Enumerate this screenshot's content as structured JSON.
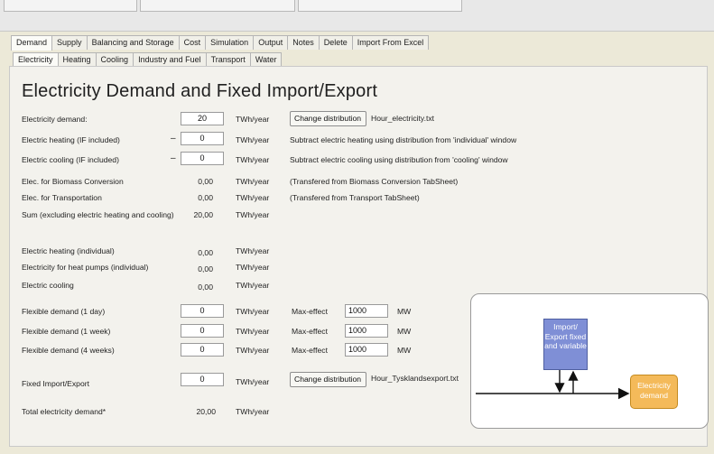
{
  "window": {
    "top_boxes": [
      "",
      "",
      ""
    ]
  },
  "main_tabs": [
    {
      "label": "Demand",
      "active": true
    },
    {
      "label": "Supply",
      "active": false
    },
    {
      "label": "Balancing and Storage",
      "active": false
    },
    {
      "label": "Cost",
      "active": false
    },
    {
      "label": "Simulation",
      "active": false
    },
    {
      "label": "Output",
      "active": false
    },
    {
      "label": "Notes",
      "active": false
    },
    {
      "label": "Delete",
      "active": false
    },
    {
      "label": "Import From Excel",
      "active": false
    }
  ],
  "sub_tabs": [
    {
      "label": "Electricity",
      "active": true
    },
    {
      "label": "Heating",
      "active": false
    },
    {
      "label": "Cooling",
      "active": false
    },
    {
      "label": "Industry and Fuel",
      "active": false
    },
    {
      "label": "Transport",
      "active": false
    },
    {
      "label": "Water",
      "active": false
    }
  ],
  "page": {
    "title": "Electricity Demand and Fixed Import/Export"
  },
  "rows": {
    "electricity_demand": {
      "label": "Electricity demand:",
      "value": "20",
      "unit": "TWh/year",
      "button": "Change distribution",
      "file": "Hour_electricity.txt"
    },
    "electric_heating": {
      "label": "Electric heating (IF included)",
      "minus": "–",
      "value": "0",
      "unit": "TWh/year",
      "note": "Subtract electric heating using distribution from 'individual' window"
    },
    "electric_cooling": {
      "label": "Electric cooling (IF included)",
      "minus": "–",
      "value": "0",
      "unit": "TWh/year",
      "note": "Subtract electric cooling using distribution from 'cooling' window"
    },
    "biomass": {
      "label": "Elec. for Biomass Conversion",
      "value": "0,00",
      "unit": "TWh/year",
      "note": "(Transfered from Biomass Conversion TabSheet)"
    },
    "transport": {
      "label": "Elec. for Transportation",
      "value": "0,00",
      "unit": "TWh/year",
      "note": "(Transfered from Transport TabSheet)"
    },
    "sum": {
      "label": "Sum (excluding electric heating and cooling)",
      "value": "20,00",
      "unit": "TWh/year"
    },
    "heating_individual": {
      "label": "Electric heating (individual)",
      "value": "0,00",
      "unit": "TWh/year"
    },
    "heat_pumps": {
      "label": "Electricity for heat pumps (individual)",
      "value": "0,00",
      "unit": "TWh/year"
    },
    "cooling": {
      "label": "Electric cooling",
      "value": "0,00",
      "unit": "TWh/year"
    },
    "flex_1day": {
      "label": "Flexible demand (1 day)",
      "value": "0",
      "unit": "TWh/year",
      "max_label": "Max-effect",
      "max_value": "1000",
      "max_unit": "MW"
    },
    "flex_1week": {
      "label": "Flexible demand (1 week)",
      "value": "0",
      "unit": "TWh/year",
      "max_label": "Max-effect",
      "max_value": "1000",
      "max_unit": "MW"
    },
    "flex_4weeks": {
      "label": "Flexible demand (4 weeks)",
      "value": "0",
      "unit": "TWh/year",
      "max_label": "Max-effect",
      "max_value": "1000",
      "max_unit": "MW"
    },
    "fixed_import": {
      "label": "Fixed Import/Export",
      "value": "0",
      "unit": "TWh/year",
      "button": "Change distribution",
      "file": "Hour_Tysklandsexport.txt"
    },
    "total": {
      "label": "Total electricity demand*",
      "value": "20,00",
      "unit": "TWh/year"
    }
  },
  "diagram": {
    "import_box": "Import/ Export fixed and variable",
    "demand_box": "Electricity demand",
    "colors": {
      "import": "#7f8fd6",
      "demand": "#f4ba5a"
    }
  }
}
